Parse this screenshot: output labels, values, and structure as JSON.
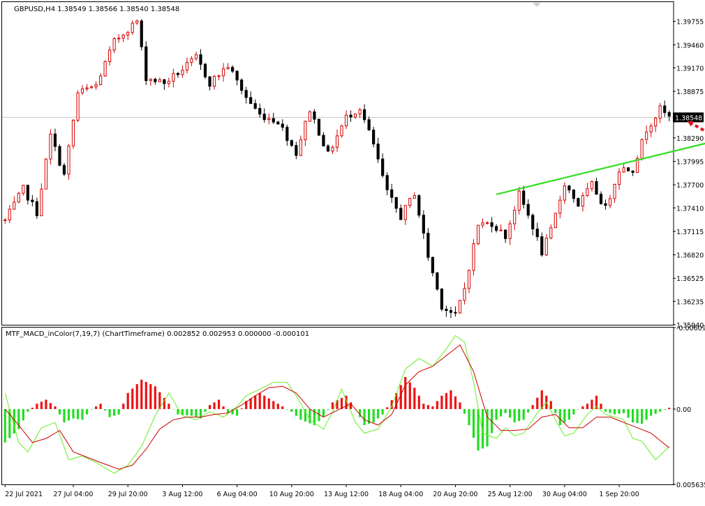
{
  "chart_data": [
    {
      "type": "candlestick",
      "symbol": "GBPUSD",
      "timeframe": "H4",
      "header": "GBPUSD,H4  1.38549 1.38566 1.38540 1.38548",
      "quote": {
        "open": "1.38549",
        "high": "1.38566",
        "low": "1.38540",
        "close": "1.38548"
      },
      "current_price": 1.38548,
      "current_price_label": "1.38548",
      "ylim": [
        1.3594,
        1.3998
      ],
      "y_ticks": [
        1.3594,
        1.36235,
        1.36525,
        1.3682,
        1.37115,
        1.3741,
        1.377,
        1.37995,
        1.3829,
        1.38875,
        1.3917,
        1.3946,
        1.39755
      ],
      "y_tick_labels": [
        "1.35940",
        "1.36235",
        "1.36525",
        "1.36820",
        "1.37115",
        "1.37410",
        "1.37700",
        "1.37995",
        "1.38290",
        "1.38875",
        "1.39170",
        "1.39460",
        "1.39755"
      ],
      "x_tick_labels": [
        "22 Jul 2021",
        "27 Jul 04:00",
        "29 Jul 20:00",
        "3 Aug 12:00",
        "6 Aug 04:00",
        "10 Aug 20:00",
        "13 Aug 12:00",
        "18 Aug 04:00",
        "20 Aug 20:00",
        "25 Aug 12:00",
        "30 Aug 04:00",
        "1 Sep 20:00"
      ],
      "x_tick_bar_index": [
        0,
        15,
        27,
        39,
        51,
        63,
        75,
        87,
        99,
        111,
        123,
        135
      ],
      "bar_count": 147,
      "colors": {
        "bull": "#d60000",
        "bear": "#000000",
        "trendline": "#33dd22",
        "arrow": "#e0181c"
      },
      "price_path": [
        [
          0,
          1.3725
        ],
        [
          4,
          1.3765
        ],
        [
          7,
          1.3735
        ],
        [
          10,
          1.3832
        ],
        [
          13,
          1.3782
        ],
        [
          16,
          1.3885
        ],
        [
          20,
          1.3895
        ],
        [
          24,
          1.395
        ],
        [
          27,
          1.3966
        ],
        [
          29,
          1.3976
        ],
        [
          31,
          1.3905
        ],
        [
          35,
          1.3898
        ],
        [
          39,
          1.3915
        ],
        [
          42,
          1.393
        ],
        [
          45,
          1.3898
        ],
        [
          49,
          1.392
        ],
        [
          53,
          1.388
        ],
        [
          56,
          1.3858
        ],
        [
          60,
          1.385
        ],
        [
          64,
          1.381
        ],
        [
          67,
          1.3865
        ],
        [
          71,
          1.3808
        ],
        [
          75,
          1.3855
        ],
        [
          78,
          1.3867
        ],
        [
          81,
          1.382
        ],
        [
          84,
          1.376
        ],
        [
          87,
          1.373
        ],
        [
          90,
          1.376
        ],
        [
          93,
          1.368
        ],
        [
          96,
          1.3618
        ],
        [
          99,
          1.3605
        ],
        [
          101,
          1.364
        ],
        [
          104,
          1.372
        ],
        [
          107,
          1.3722
        ],
        [
          110,
          1.3705
        ],
        [
          113,
          1.3758
        ],
        [
          116,
          1.3718
        ],
        [
          118,
          1.3685
        ],
        [
          120,
          1.3712
        ],
        [
          123,
          1.3772
        ],
        [
          126,
          1.3745
        ],
        [
          129,
          1.377
        ],
        [
          132,
          1.374
        ],
        [
          135,
          1.379
        ],
        [
          138,
          1.379
        ],
        [
          141,
          1.384
        ],
        [
          144,
          1.3865
        ],
        [
          146,
          1.38548
        ]
      ],
      "annotations": [
        {
          "kind": "trendline",
          "from": [
            108,
            1.3758
          ],
          "to": [
            169,
            1.3843
          ]
        },
        {
          "kind": "dotted-arrow",
          "from": [
            156,
            1.3831
          ],
          "to": [
            150,
            1.385
          ]
        },
        {
          "kind": "dotted-arrow",
          "from": [
            156,
            1.3831
          ],
          "to": [
            161,
            1.3892
          ]
        }
      ]
    },
    {
      "type": "macd-histogram",
      "label": "MTF_MACD_inColor(7,19,7) (ChartTimeframe) 0.002852 0.002953 0.000000 -0.000101",
      "ylim": [
        -0.006097,
        0.005635
      ],
      "y_tick_labels": [
        "0.005635",
        "0.00",
        "-0.006097"
      ],
      "y_ticks": [
        0.005635,
        0.0,
        -0.006097
      ],
      "colors": {
        "positive": "#22dd22",
        "negative": "#ee1111",
        "main": "#66ee22",
        "signal": "#cc0000"
      },
      "histogram": [
        [
          0,
          0.0025
        ],
        [
          3,
          0.0015
        ],
        [
          5,
          0.0002
        ],
        [
          7,
          -0.0004
        ],
        [
          9,
          -0.0007
        ],
        [
          11,
          -0.0002
        ],
        [
          13,
          0.001
        ],
        [
          15,
          0.0007
        ],
        [
          17,
          0.0008
        ],
        [
          19,
          0.0
        ],
        [
          21,
          -0.0004
        ],
        [
          23,
          0.0006
        ],
        [
          25,
          0.0004
        ],
        [
          27,
          -0.0012
        ],
        [
          30,
          -0.0022
        ],
        [
          33,
          -0.0017
        ],
        [
          36,
          -0.0004
        ],
        [
          38,
          0.0004
        ],
        [
          41,
          0.0005
        ],
        [
          43,
          0.0007
        ],
        [
          45,
          -0.0003
        ],
        [
          47,
          -0.0007
        ],
        [
          49,
          0.0003
        ],
        [
          51,
          0.0005
        ],
        [
          53,
          -0.0006
        ],
        [
          56,
          -0.0012
        ],
        [
          59,
          -0.0006
        ],
        [
          61,
          -0.0002
        ],
        [
          63,
          0.0002
        ],
        [
          65,
          0.0008
        ],
        [
          68,
          0.0012
        ],
        [
          70,
          0.0006
        ],
        [
          72,
          -0.0005
        ],
        [
          75,
          -0.001
        ],
        [
          77,
          0.0
        ],
        [
          79,
          0.0012
        ],
        [
          81,
          0.001
        ],
        [
          83,
          0.0004
        ],
        [
          86,
          -0.0012
        ],
        [
          88,
          -0.0024
        ],
        [
          90,
          -0.0016
        ],
        [
          92,
          -0.0004
        ],
        [
          94,
          -0.0002
        ],
        [
          96,
          -0.001
        ],
        [
          98,
          -0.0014
        ],
        [
          100,
          -0.0005
        ],
        [
          102,
          0.0012
        ],
        [
          104,
          0.0031
        ],
        [
          106,
          0.0028
        ],
        [
          108,
          0.0008
        ],
        [
          110,
          0.0003
        ],
        [
          112,
          0.001
        ],
        [
          114,
          0.0008
        ],
        [
          116,
          -0.0003
        ],
        [
          118,
          -0.0014
        ],
        [
          120,
          -0.0006
        ],
        [
          122,
          0.0012
        ],
        [
          124,
          0.0008
        ],
        [
          126,
          0.0
        ],
        [
          128,
          -0.0004
        ],
        [
          130,
          -0.001
        ],
        [
          132,
          0.0002
        ],
        [
          134,
          0.0004
        ],
        [
          136,
          0.0003
        ],
        [
          138,
          0.001
        ],
        [
          140,
          0.0011
        ],
        [
          142,
          0.0005
        ],
        [
          144,
          0.0002
        ],
        [
          146,
          -0.0001
        ]
      ],
      "main_line": [
        [
          0,
          -0.0012
        ],
        [
          3,
          0.0025
        ],
        [
          5,
          0.0032
        ],
        [
          8,
          0.0014
        ],
        [
          11,
          0.001
        ],
        [
          14,
          0.0038
        ],
        [
          17,
          0.0035
        ],
        [
          20,
          0.004
        ],
        [
          24,
          0.0048
        ],
        [
          27,
          0.0042
        ],
        [
          30,
          0.0028
        ],
        [
          33,
          0.0005
        ],
        [
          36,
          -0.0012
        ],
        [
          39,
          0.0005
        ],
        [
          42,
          0.0008
        ],
        [
          45,
          0.0002
        ],
        [
          48,
          0.0006
        ],
        [
          51,
          -0.0002
        ],
        [
          53,
          -0.001
        ],
        [
          56,
          -0.0015
        ],
        [
          59,
          -0.002
        ],
        [
          62,
          -0.002
        ],
        [
          64,
          -0.001
        ],
        [
          67,
          0.0008
        ],
        [
          70,
          0.0015
        ],
        [
          72,
          0.0002
        ],
        [
          74,
          -0.0015
        ],
        [
          77,
          0.001
        ],
        [
          79,
          0.0018
        ],
        [
          82,
          0.0015
        ],
        [
          85,
          -0.0002
        ],
        [
          88,
          -0.003
        ],
        [
          91,
          -0.0038
        ],
        [
          94,
          -0.0032
        ],
        [
          97,
          -0.0045
        ],
        [
          99,
          -0.0055
        ],
        [
          101,
          -0.005
        ],
        [
          103,
          -0.002
        ],
        [
          105,
          0.0018
        ],
        [
          108,
          0.0022
        ],
        [
          110,
          0.0014
        ],
        [
          112,
          0.002
        ],
        [
          114,
          0.0018
        ],
        [
          117,
          0.0003
        ],
        [
          119,
          -0.0005
        ],
        [
          121,
          0.0008
        ],
        [
          123,
          0.002
        ],
        [
          125,
          0.0018
        ],
        [
          128,
          0.0004
        ],
        [
          130,
          -0.0002
        ],
        [
          132,
          0.0004
        ],
        [
          134,
          0.0006
        ],
        [
          136,
          0.0008
        ],
        [
          138,
          0.0022
        ],
        [
          140,
          0.0024
        ],
        [
          143,
          0.0038
        ],
        [
          146,
          0.0028
        ]
      ],
      "signal_line": [
        [
          0,
          0.0
        ],
        [
          3,
          0.0012
        ],
        [
          6,
          0.0025
        ],
        [
          9,
          0.0022
        ],
        [
          12,
          0.0016
        ],
        [
          15,
          0.0032
        ],
        [
          18,
          0.0036
        ],
        [
          21,
          0.004
        ],
        [
          25,
          0.0045
        ],
        [
          28,
          0.0042
        ],
        [
          31,
          0.003
        ],
        [
          34,
          0.0015
        ],
        [
          37,
          0.0008
        ],
        [
          40,
          0.0006
        ],
        [
          43,
          0.0006
        ],
        [
          46,
          0.0004
        ],
        [
          49,
          0.0003
        ],
        [
          52,
          -0.0003
        ],
        [
          55,
          -0.001
        ],
        [
          58,
          -0.0016
        ],
        [
          61,
          -0.0017
        ],
        [
          64,
          -0.0012
        ],
        [
          67,
          0.0
        ],
        [
          70,
          0.0006
        ],
        [
          73,
          0.0001
        ],
        [
          76,
          -0.0004
        ],
        [
          79,
          0.0008
        ],
        [
          82,
          0.0012
        ],
        [
          85,
          0.0004
        ],
        [
          88,
          -0.0018
        ],
        [
          91,
          -0.0028
        ],
        [
          94,
          -0.0032
        ],
        [
          97,
          -0.004
        ],
        [
          100,
          -0.0048
        ],
        [
          103,
          -0.0028
        ],
        [
          106,
          0.0006
        ],
        [
          109,
          0.0016
        ],
        [
          112,
          0.0016
        ],
        [
          115,
          0.0015
        ],
        [
          118,
          0.0006
        ],
        [
          121,
          0.0004
        ],
        [
          124,
          0.0014
        ],
        [
          127,
          0.0014
        ],
        [
          130,
          0.0006
        ],
        [
          133,
          0.0006
        ],
        [
          136,
          0.001
        ],
        [
          139,
          0.0014
        ],
        [
          142,
          0.0018
        ],
        [
          146,
          0.0029
        ]
      ]
    }
  ]
}
